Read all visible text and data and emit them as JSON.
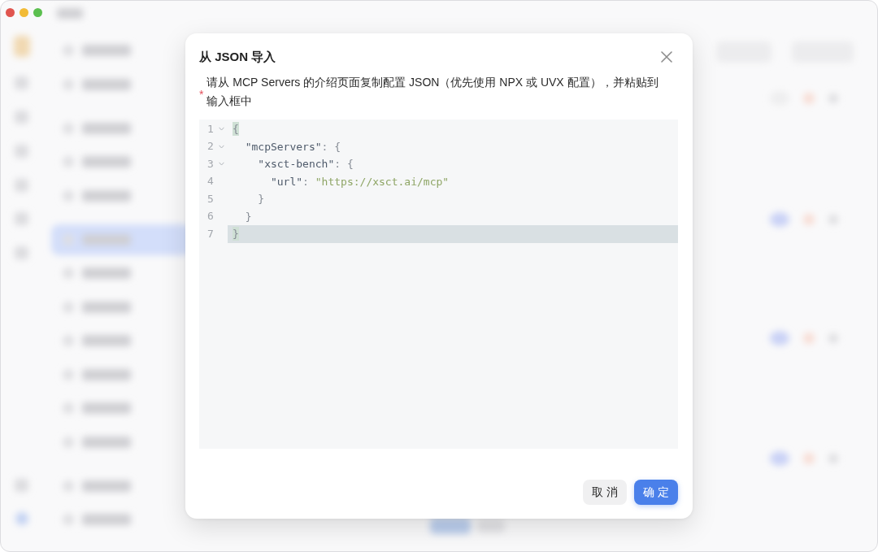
{
  "dialog": {
    "title": "从 JSON 导入",
    "description": {
      "required_mark": "*",
      "text": "请从 MCP Servers 的介绍页面复制配置 JSON（优先使用 NPX 或 UVX 配置），并粘贴到输入框中"
    },
    "editor": {
      "lines": [
        {
          "number": "1",
          "active": false,
          "bracket_match": true,
          "tokens": [
            {
              "kind": "punct",
              "text": "{"
            }
          ],
          "children": [
            {
              "number": "2",
              "active": false,
              "bracket_match": false,
              "tokens": [
                {
                  "kind": "key",
                  "text": "\"mcpServers\""
                },
                {
                  "kind": "punct",
                  "text": ": {"
                }
              ],
              "children": [
                {
                  "number": "3",
                  "active": false,
                  "bracket_match": false,
                  "tokens": [
                    {
                      "kind": "key",
                      "text": "\"xsct-bench\""
                    },
                    {
                      "kind": "punct",
                      "text": ": {"
                    }
                  ],
                  "children": [
                    {
                      "number": "4",
                      "active": false,
                      "bracket_match": false,
                      "tokens": [
                        {
                          "kind": "key",
                          "text": "\"url\""
                        },
                        {
                          "kind": "punct",
                          "text": ": "
                        },
                        {
                          "kind": "string",
                          "text": "\"https://xsct.ai/mcp\""
                        }
                      ]
                    }
                  ]
                },
                {
                  "number": "5",
                  "active": false,
                  "bracket_match": false,
                  "tokens": [
                    {
                      "kind": "punct",
                      "text": "}"
                    }
                  ]
                }
              ]
            },
            {
              "number": "6",
              "active": false,
              "bracket_match": false,
              "tokens": [
                {
                  "kind": "punct",
                  "text": "}"
                }
              ]
            }
          ]
        },
        {
          "number": "7",
          "active": true,
          "bracket_match": true,
          "tokens": [
            {
              "kind": "punct",
              "text": "}"
            }
          ]
        }
      ]
    },
    "buttons": [
      {
        "label": "取 消",
        "kind": "default"
      },
      {
        "label": "确 定",
        "kind": "primary"
      }
    ]
  }
}
